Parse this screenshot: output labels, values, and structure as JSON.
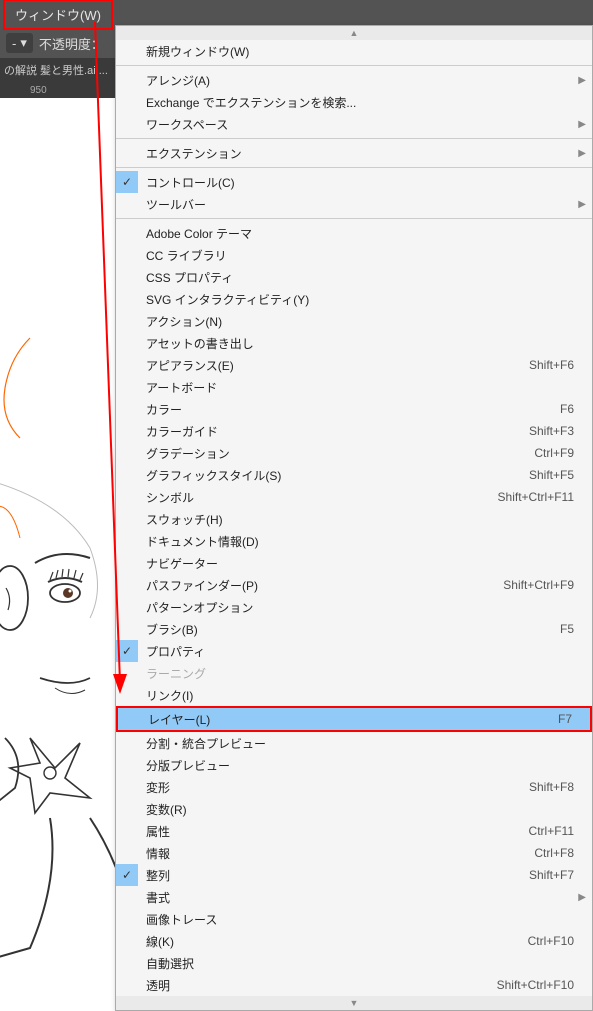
{
  "topbar": {
    "menu_tab": "ウィンドウ(W)",
    "opacity_label": "不透明度：",
    "dash_label": "-"
  },
  "filebar": {
    "filename": "の解説 髪と男性.ai ..."
  },
  "ruler": {
    "marks": [
      "950"
    ]
  },
  "menu": {
    "scroll_up": "▲",
    "scroll_down": "▼",
    "items": [
      {
        "label": "新規ウィンドウ(W)",
        "type": "item"
      },
      {
        "type": "sep"
      },
      {
        "label": "アレンジ(A)",
        "type": "sub"
      },
      {
        "label": "Exchange でエクステンションを検索...",
        "type": "item"
      },
      {
        "label": "ワークスペース",
        "type": "sub"
      },
      {
        "type": "sep"
      },
      {
        "label": "エクステンション",
        "type": "sub"
      },
      {
        "type": "sep"
      },
      {
        "label": "コントロール(C)",
        "type": "item",
        "checked": true
      },
      {
        "label": "ツールバー",
        "type": "sub"
      },
      {
        "type": "sep"
      },
      {
        "label": "Adobe Color テーマ",
        "type": "item"
      },
      {
        "label": "CC ライブラリ",
        "type": "item"
      },
      {
        "label": "CSS プロパティ",
        "type": "item"
      },
      {
        "label": "SVG インタラクティビティ(Y)",
        "type": "item"
      },
      {
        "label": "アクション(N)",
        "type": "item"
      },
      {
        "label": "アセットの書き出し",
        "type": "item"
      },
      {
        "label": "アピアランス(E)",
        "type": "item",
        "shortcut": "Shift+F6"
      },
      {
        "label": "アートボード",
        "type": "item"
      },
      {
        "label": "カラー",
        "type": "item",
        "shortcut": "F6"
      },
      {
        "label": "カラーガイド",
        "type": "item",
        "shortcut": "Shift+F3"
      },
      {
        "label": "グラデーション",
        "type": "item",
        "shortcut": "Ctrl+F9"
      },
      {
        "label": "グラフィックスタイル(S)",
        "type": "item",
        "shortcut": "Shift+F5"
      },
      {
        "label": "シンボル",
        "type": "item",
        "shortcut": "Shift+Ctrl+F11"
      },
      {
        "label": "スウォッチ(H)",
        "type": "item"
      },
      {
        "label": "ドキュメント情報(D)",
        "type": "item"
      },
      {
        "label": "ナビゲーター",
        "type": "item"
      },
      {
        "label": "パスファインダー(P)",
        "type": "item",
        "shortcut": "Shift+Ctrl+F9"
      },
      {
        "label": "パターンオプション",
        "type": "item"
      },
      {
        "label": "ブラシ(B)",
        "type": "item",
        "shortcut": "F5"
      },
      {
        "label": "プロパティ",
        "type": "item",
        "checked": true
      },
      {
        "label": "ラーニング",
        "type": "item",
        "disabled": true
      },
      {
        "label": "リンク(I)",
        "type": "item"
      },
      {
        "label": "レイヤー(L)",
        "type": "item",
        "shortcut": "F7",
        "highlight": true
      },
      {
        "label": "分割・統合プレビュー",
        "type": "item"
      },
      {
        "label": "分版プレビュー",
        "type": "item"
      },
      {
        "label": "変形",
        "type": "item",
        "shortcut": "Shift+F8"
      },
      {
        "label": "変数(R)",
        "type": "item"
      },
      {
        "label": "属性",
        "type": "item",
        "shortcut": "Ctrl+F11"
      },
      {
        "label": "情報",
        "type": "item",
        "shortcut": "Ctrl+F8"
      },
      {
        "label": "整列",
        "type": "item",
        "checked": true,
        "shortcut": "Shift+F7"
      },
      {
        "label": "書式",
        "type": "sub"
      },
      {
        "label": "画像トレース",
        "type": "item"
      },
      {
        "label": "線(K)",
        "type": "item",
        "shortcut": "Ctrl+F10"
      },
      {
        "label": "自動選択",
        "type": "item"
      },
      {
        "label": "透明",
        "type": "item",
        "shortcut": "Shift+Ctrl+F10"
      }
    ]
  }
}
